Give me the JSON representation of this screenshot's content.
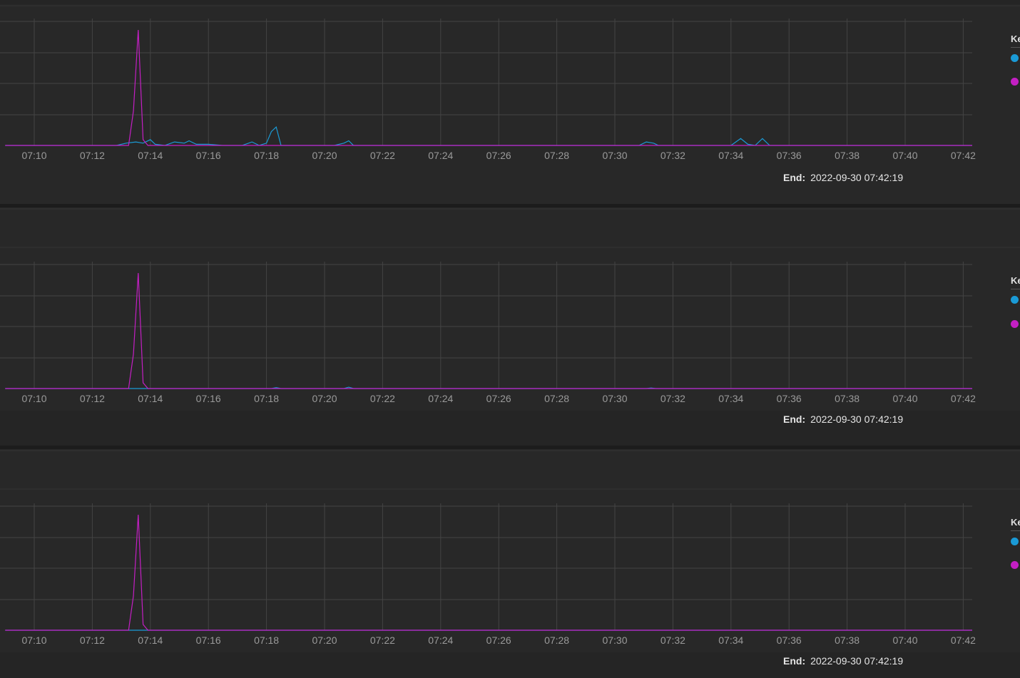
{
  "colors": {
    "series_a": "#1a9ad6",
    "series_b": "#c41fc4",
    "grid": "#444444",
    "axis_text": "#9a9a9a"
  },
  "legend": {
    "title_fragment": "Ke"
  },
  "end_label": "End:",
  "end_value": "2022-09-30 07:42:19",
  "chart_data": [
    {
      "type": "line",
      "x_ticks": [
        "07:10",
        "07:12",
        "07:14",
        "07:16",
        "07:18",
        "07:20",
        "07:22",
        "07:24",
        "07:26",
        "07:28",
        "07:30",
        "07:32",
        "07:34",
        "07:36",
        "07:38",
        "07:40",
        "07:42"
      ],
      "xlim": [
        "07:09",
        "07:42:19"
      ],
      "ylim": [
        0,
        1
      ],
      "grid": true,
      "legend_placement": "right",
      "series": [
        {
          "color": "#1a9ad6",
          "points": [
            [
              "07:09",
              0
            ],
            [
              "07:12:50",
              0
            ],
            [
              "07:13:10",
              0.02
            ],
            [
              "07:13:30",
              0.03
            ],
            [
              "07:13:45",
              0.02
            ],
            [
              "07:14:00",
              0.05
            ],
            [
              "07:14:10",
              0.01
            ],
            [
              "07:14:30",
              0
            ],
            [
              "07:14:50",
              0.03
            ],
            [
              "07:15:10",
              0.02
            ],
            [
              "07:15:20",
              0.04
            ],
            [
              "07:15:35",
              0.01
            ],
            [
              "07:16:00",
              0.01
            ],
            [
              "07:16:30",
              0
            ],
            [
              "07:17:10",
              0
            ],
            [
              "07:17:30",
              0.03
            ],
            [
              "07:17:45",
              0
            ],
            [
              "07:18:00",
              0.02
            ],
            [
              "07:18:10",
              0.12
            ],
            [
              "07:18:20",
              0.16
            ],
            [
              "07:18:30",
              0
            ],
            [
              "07:20:20",
              0
            ],
            [
              "07:20:40",
              0.02
            ],
            [
              "07:20:50",
              0.04
            ],
            [
              "07:21:00",
              0
            ],
            [
              "07:30:50",
              0
            ],
            [
              "07:31:05",
              0.03
            ],
            [
              "07:31:20",
              0.02
            ],
            [
              "07:31:30",
              0
            ],
            [
              "07:34:00",
              0
            ],
            [
              "07:34:20",
              0.06
            ],
            [
              "07:34:35",
              0.01
            ],
            [
              "07:34:50",
              0
            ],
            [
              "07:35:05",
              0.06
            ],
            [
              "07:35:20",
              0
            ],
            [
              "07:42:19",
              0
            ]
          ]
        },
        {
          "color": "#c41fc4",
          "points": [
            [
              "07:09",
              0
            ],
            [
              "07:13:15",
              0
            ],
            [
              "07:13:25",
              0.3
            ],
            [
              "07:13:35",
              1.0
            ],
            [
              "07:13:45",
              0.05
            ],
            [
              "07:13:55",
              0
            ],
            [
              "07:42:19",
              0
            ]
          ]
        }
      ]
    },
    {
      "type": "line",
      "x_ticks": [
        "07:10",
        "07:12",
        "07:14",
        "07:16",
        "07:18",
        "07:20",
        "07:22",
        "07:24",
        "07:26",
        "07:28",
        "07:30",
        "07:32",
        "07:34",
        "07:36",
        "07:38",
        "07:40",
        "07:42"
      ],
      "xlim": [
        "07:09",
        "07:42:19"
      ],
      "ylim": [
        0,
        1
      ],
      "grid": true,
      "legend_placement": "right",
      "series": [
        {
          "color": "#1a9ad6",
          "points": [
            [
              "07:09",
              0
            ],
            [
              "07:18:10",
              0
            ],
            [
              "07:18:20",
              0.008
            ],
            [
              "07:18:30",
              0
            ],
            [
              "07:20:40",
              0
            ],
            [
              "07:20:50",
              0.012
            ],
            [
              "07:21:00",
              0
            ],
            [
              "07:31:05",
              0
            ],
            [
              "07:31:15",
              0.005
            ],
            [
              "07:31:25",
              0
            ],
            [
              "07:42:19",
              0
            ]
          ]
        },
        {
          "color": "#c41fc4",
          "points": [
            [
              "07:09",
              0
            ],
            [
              "07:13:15",
              0
            ],
            [
              "07:13:25",
              0.3
            ],
            [
              "07:13:35",
              1.0
            ],
            [
              "07:13:45",
              0.05
            ],
            [
              "07:13:55",
              0
            ],
            [
              "07:42:19",
              0
            ]
          ]
        }
      ]
    },
    {
      "type": "line",
      "x_ticks": [
        "07:10",
        "07:12",
        "07:14",
        "07:16",
        "07:18",
        "07:20",
        "07:22",
        "07:24",
        "07:26",
        "07:28",
        "07:30",
        "07:32",
        "07:34",
        "07:36",
        "07:38",
        "07:40",
        "07:42"
      ],
      "xlim": [
        "07:09",
        "07:42:19"
      ],
      "ylim": [
        0,
        1
      ],
      "grid": true,
      "legend_placement": "right",
      "series": [
        {
          "color": "#1a9ad6",
          "points": [
            [
              "07:09",
              0
            ],
            [
              "07:42:19",
              0
            ]
          ]
        },
        {
          "color": "#c41fc4",
          "points": [
            [
              "07:09",
              0
            ],
            [
              "07:13:15",
              0
            ],
            [
              "07:13:25",
              0.3
            ],
            [
              "07:13:35",
              1.0
            ],
            [
              "07:13:45",
              0.05
            ],
            [
              "07:13:55",
              0
            ],
            [
              "07:42:19",
              0
            ]
          ]
        }
      ]
    }
  ]
}
